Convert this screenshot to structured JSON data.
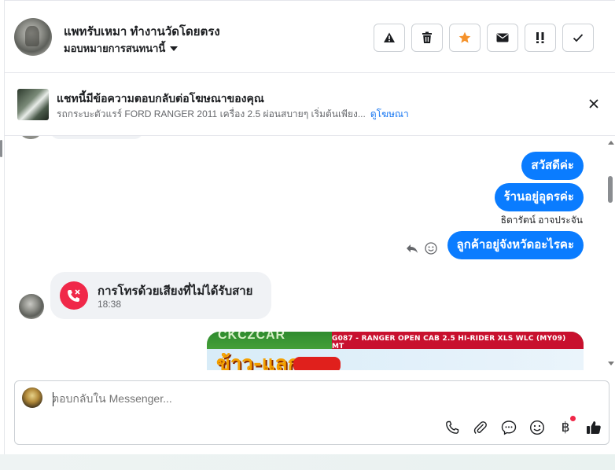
{
  "header": {
    "contact_name": "แพทรับเหมา ทำงานวัดโดยตรง",
    "assign_label": "มอบหมายการสนทนานี้",
    "actions": [
      "report-spam",
      "delete",
      "star",
      "mark-unread",
      "follow-up",
      "done"
    ]
  },
  "ad_banner": {
    "title": "แชทนี้มีข้อความตอบกลับต่อโฆษณาของคุณ",
    "description": "รถกระบะตัวแรร์ FORD RANGER 2011 เครื่อง 2.5 ผ่อนสบายๆ เริ่มต้นเพียง...",
    "link": "ดูโฆษณา"
  },
  "messages": {
    "outgoing": [
      {
        "text": "สวัสดีค่ะ"
      },
      {
        "text": "ร้านอยู่อุดรค่ะ"
      },
      {
        "text": "ลูกค้าอยู่จังหวัดอะไรคะ"
      }
    ],
    "sender_label": "ธิดารัตน์ อาจประจัน",
    "missed_call": {
      "title": "การโทรด้วยเสียงที่ไม่ได้รับสาย",
      "time": "18:38"
    },
    "promo_image": {
      "top_text": "CKCZCAR",
      "banner_text": "G087 - RANGER OPEN CAB 2.5 HI-RIDER XLS WLC (MY09) MT",
      "headline": "ข้าว-แลก-รถ"
    }
  },
  "composer": {
    "placeholder": "ตอบกลับใน Messenger...",
    "tools": [
      "phone-icon",
      "attachment-icon",
      "saved-reply-icon",
      "emoji-icon",
      "baht-payment-icon",
      "thumbs-up-icon"
    ]
  },
  "colors": {
    "outgoing_bubble": "#0a7cff",
    "missed_call": "#f02849",
    "link": "#1877f2",
    "star": "#f5922b"
  }
}
